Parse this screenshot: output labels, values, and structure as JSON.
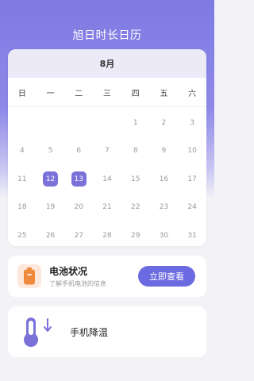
{
  "header": {
    "title": "旭日时长日历"
  },
  "calendar": {
    "month": "8月",
    "weekdays": [
      "日",
      "一",
      "二",
      "三",
      "四",
      "五",
      "六"
    ],
    "weeks": [
      [
        "",
        "",
        "",
        "",
        "1",
        "2",
        "3"
      ],
      [
        "4",
        "5",
        "6",
        "7",
        "8",
        "9",
        "10"
      ],
      [
        "11",
        "12",
        "13",
        "14",
        "15",
        "16",
        "17"
      ],
      [
        "18",
        "19",
        "20",
        "21",
        "22",
        "23",
        "24"
      ],
      [
        "25",
        "26",
        "27",
        "28",
        "29",
        "30",
        "31"
      ]
    ],
    "selected_days": [
      "12",
      "13"
    ]
  },
  "battery": {
    "title": "电池状况",
    "subtitle": "了解手机电池的信息",
    "button_label": "立即查看",
    "icon": "battery-icon"
  },
  "cooling": {
    "label": "手机降温",
    "icon": "thermometer-down-icon"
  },
  "colors": {
    "accent": "#6c6ae0",
    "selected_day": "#7b72d9",
    "battery_icon_bg": "#fde8db",
    "battery_icon": "#f08a3c"
  }
}
